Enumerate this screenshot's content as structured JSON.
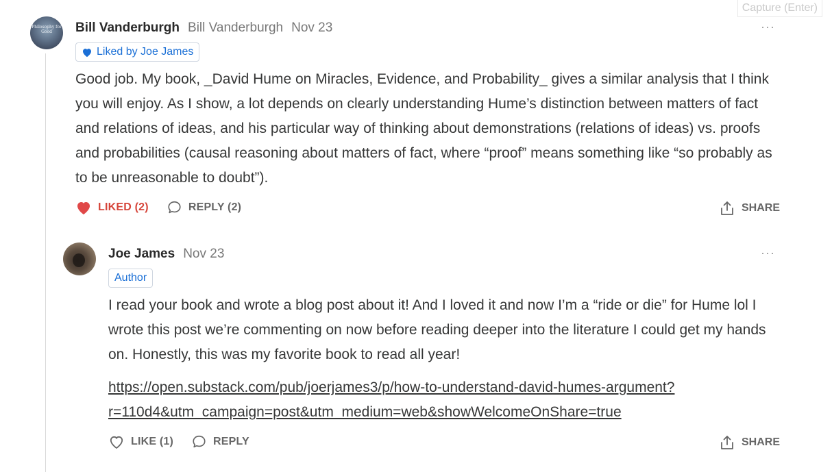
{
  "capture_hint": "Capture (Enter)",
  "comments": [
    {
      "author": "Bill Vanderburgh",
      "handle": "Bill Vanderburgh",
      "date": "Nov 23",
      "avatar_text": "Philosophy for Good",
      "badge": "Liked by Joe James",
      "body": "Good job. My book, _David Hume on Miracles, Evidence, and Probability_ gives a similar analysis that I think you will enjoy. As I show, a lot depends on clearly understanding Hume’s distinction between matters of fact and relations of ideas, and his particular way of thinking about demonstrations (relations of ideas) vs. proofs and probabilities (causal reasoning about matters of fact, where “proof” means something like “so probably as to be unreasonable to doubt”).",
      "like_label": "LIKED (2)",
      "reply_label": "REPLY (2)",
      "share_label": "SHARE",
      "more": "···"
    },
    {
      "author": "Joe James",
      "date": "Nov 23",
      "badge": "Author",
      "body": "I read your book and wrote a blog post about it! And I loved it and now I’m a “ride or die” for Hume lol I wrote this post we’re commenting on now before reading deeper into the literature I could get my hands on. Honestly, this was my favorite book to read all year!",
      "link_line1": "https://open.substack.com/pub/joerjames3/p/how-to-understand-david-humes-argument?",
      "link_line2": "r=110d4&utm_campaign=post&utm_medium=web&showWelcomeOnShare=true",
      "like_label": "LIKE (1)",
      "reply_label": "REPLY",
      "share_label": "SHARE",
      "more": "···"
    }
  ],
  "colors": {
    "accent": "#1a6fd6",
    "liked": "#d6453a",
    "text": "#363737",
    "muted": "#777777"
  },
  "icons": [
    "heart-filled-icon",
    "heart-outline-icon",
    "speech-bubble-icon",
    "share-icon",
    "more-dots-icon"
  ]
}
